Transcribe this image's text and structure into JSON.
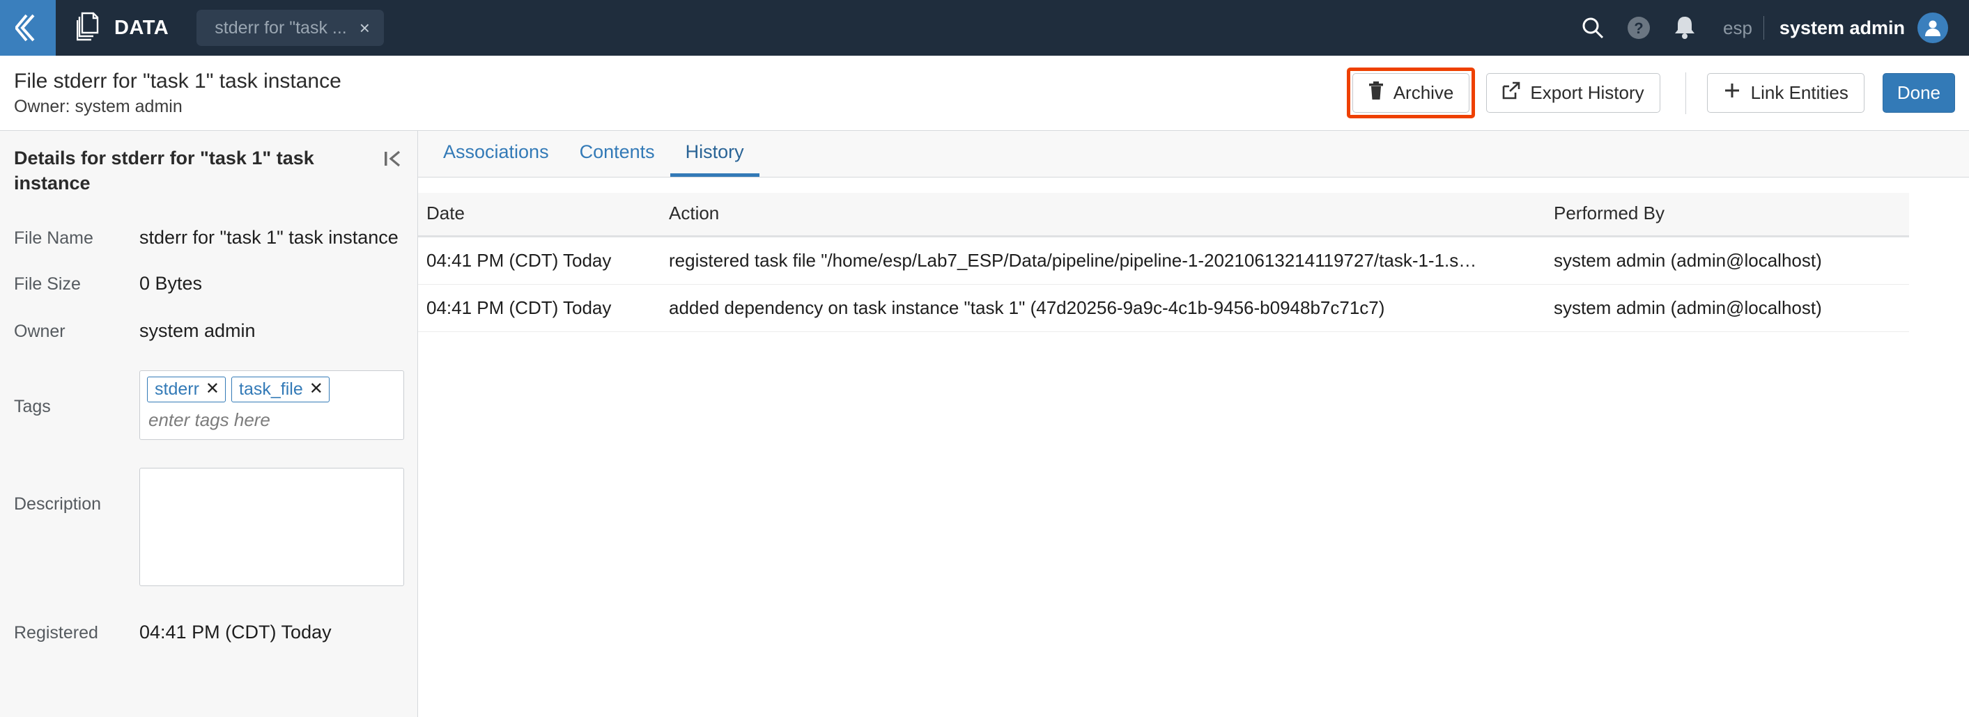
{
  "topbar": {
    "back_icon": "chevron-double-left-icon",
    "app_icon": "stacked-documents-icon",
    "app_label": "DATA",
    "open_tab": {
      "label": "stderr for \"task ...",
      "close": "×"
    },
    "search_icon": "search-icon",
    "help_icon": "help-circle-icon",
    "notifications_icon": "bell-icon",
    "tenant": "esp",
    "separator": "|",
    "user_name": "system admin",
    "avatar_icon": "user-avatar-icon",
    "bg_color": "#1f2d3d",
    "accent_color": "#3a7fbd"
  },
  "header": {
    "title": "File stderr for \"task 1\" task instance",
    "subtitle": "Owner: system admin",
    "actions": {
      "archive": {
        "label": "Archive",
        "icon": "trash-icon",
        "highlighted": true,
        "highlight_color": "#ee4000"
      },
      "export_history": {
        "label": "Export History",
        "icon": "external-link-icon"
      },
      "link_entities": {
        "label": "Link Entities",
        "icon": "plus-icon"
      },
      "done": {
        "label": "Done",
        "color": "#337ab7"
      }
    }
  },
  "details": {
    "panel_title": "Details for stderr for \"task 1\" task instance",
    "collapse_icon": "collapse-left-icon",
    "fields": {
      "file_name_label": "File Name",
      "file_name_value": "stderr for \"task 1\" task instance",
      "file_size_label": "File Size",
      "file_size_value": "0 Bytes",
      "owner_label": "Owner",
      "owner_value": "system admin",
      "tags_label": "Tags",
      "tags": [
        "stderr",
        "task_file"
      ],
      "tags_placeholder": "enter tags here",
      "description_label": "Description",
      "description_value": "",
      "registered_label": "Registered",
      "registered_value": "04:41 PM (CDT) Today"
    }
  },
  "content": {
    "tabs": [
      {
        "label": "Associations",
        "active": false
      },
      {
        "label": "Contents",
        "active": false
      },
      {
        "label": "History",
        "active": true
      }
    ],
    "history_table": {
      "columns": [
        "Date",
        "Action",
        "Performed By"
      ],
      "rows": [
        {
          "date": "04:41 PM (CDT) Today",
          "action": "registered task file \"/home/esp/Lab7_ESP/Data/pipeline/pipeline-1-20210613214119727/task-1-1.s…",
          "performed_by": "system admin (admin@localhost)"
        },
        {
          "date": "04:41 PM (CDT) Today",
          "action": "added dependency on task instance \"task 1\" (47d20256-9a9c-4c1b-9456-b0948b7c71c7)",
          "performed_by": "system admin (admin@localhost)"
        }
      ]
    }
  }
}
